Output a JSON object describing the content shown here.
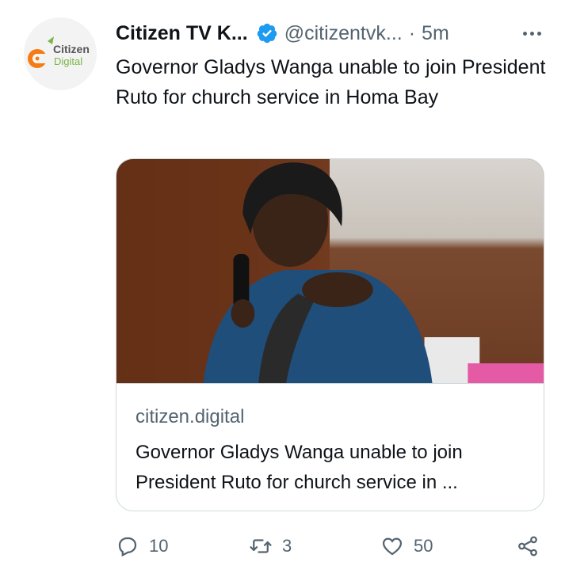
{
  "tweet": {
    "avatar_text_1": "Citizen",
    "avatar_text_2": "Digital",
    "display_name": "Citizen TV K...",
    "handle": "@citizentvk...",
    "separator": "·",
    "time": "5m",
    "text": "Governor Gladys Wanga unable to join President Ruto for church service in Homa Bay"
  },
  "card": {
    "domain": "citizen.digital",
    "title": "Governor Gladys Wanga unable to join President Ruto for church service in ..."
  },
  "actions": {
    "replies": "10",
    "retweets": "3",
    "likes": "50"
  },
  "colors": {
    "verified": "#1d9bf0",
    "muted": "#536471",
    "border": "#cfd9de",
    "brand_orange": "#f57c14",
    "brand_green": "#7ab648"
  }
}
